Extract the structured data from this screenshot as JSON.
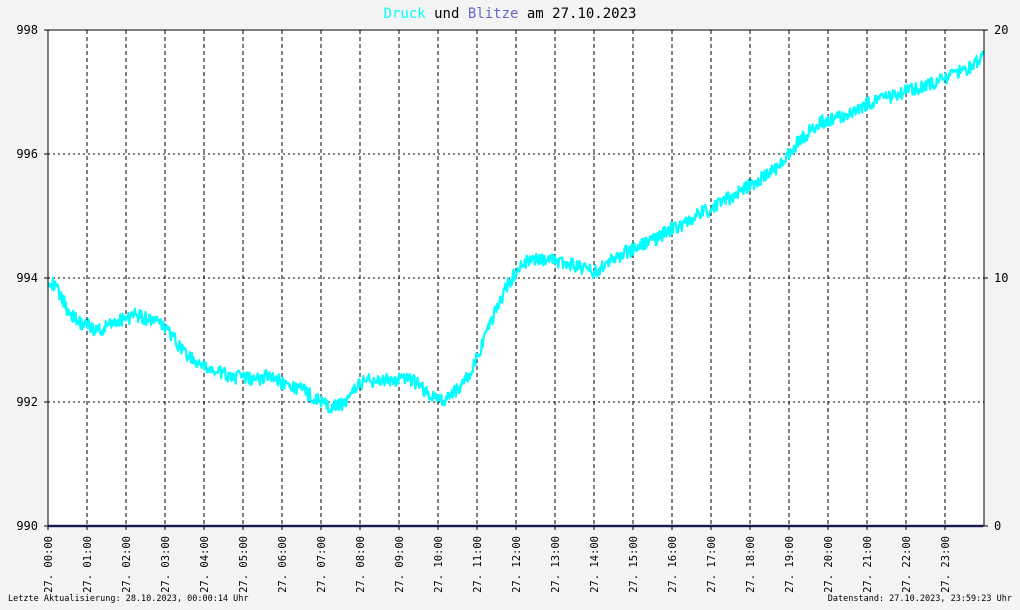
{
  "chart_data": {
    "type": "line",
    "title": {
      "part1": "Druck",
      "part2": " und ",
      "part3": "Blitze",
      "part4": " am 27.10.2023"
    },
    "y_left": {
      "ylim": [
        990,
        998
      ],
      "ticks": [
        "990",
        "992",
        "994",
        "996",
        "998"
      ]
    },
    "y_right": {
      "ylim": [
        0,
        20
      ],
      "ticks": [
        "0",
        "10",
        "20"
      ]
    },
    "x_ticks": [
      "27. 00:00",
      "27. 01:00",
      "27. 02:00",
      "27. 03:00",
      "27. 04:00",
      "27. 05:00",
      "27. 06:00",
      "27. 07:00",
      "27. 08:00",
      "27. 09:00",
      "27. 10:00",
      "27. 11:00",
      "27. 12:00",
      "27. 13:00",
      "27. 14:00",
      "27. 15:00",
      "27. 16:00",
      "27. 17:00",
      "27. 18:00",
      "27. 19:00",
      "27. 20:00",
      "27. 21:00",
      "27. 22:00",
      "27. 23:00"
    ],
    "grid": true,
    "colors": {
      "druck": "#00ffff",
      "blitze": "#333399",
      "title_text": "#000000"
    },
    "series": [
      {
        "name": "Druck",
        "x": [
          0,
          0.25,
          0.5,
          0.75,
          1,
          1.25,
          1.5,
          1.75,
          2,
          2.25,
          2.5,
          2.75,
          3,
          3.25,
          3.5,
          3.75,
          4,
          4.25,
          4.5,
          4.75,
          5,
          5.25,
          5.5,
          5.75,
          6,
          6.25,
          6.5,
          6.75,
          7,
          7.25,
          7.5,
          7.75,
          8,
          8.25,
          8.5,
          8.75,
          9,
          9.25,
          9.5,
          9.75,
          10,
          10.25,
          10.5,
          10.75,
          11,
          11.25,
          11.5,
          11.75,
          12,
          12.25,
          12.5,
          12.75,
          13,
          13.25,
          13.5,
          13.75,
          14,
          14.25,
          14.5,
          14.75,
          15,
          15.25,
          15.5,
          15.75,
          16,
          16.25,
          16.5,
          16.75,
          17,
          17.25,
          17.5,
          17.75,
          18,
          18.25,
          18.5,
          18.75,
          19,
          19.25,
          19.5,
          19.75,
          20,
          20.25,
          20.5,
          20.75,
          21,
          21.25,
          21.5,
          21.75,
          22,
          22.25,
          22.5,
          22.75,
          23,
          23.25,
          23.5,
          23.75,
          23.98
        ],
        "y": [
          994.0,
          993.8,
          993.5,
          993.3,
          993.25,
          993.15,
          993.2,
          993.3,
          993.35,
          993.4,
          993.35,
          993.3,
          993.2,
          993.0,
          992.8,
          992.65,
          992.55,
          992.5,
          992.45,
          992.4,
          992.4,
          992.35,
          992.4,
          992.45,
          992.3,
          992.25,
          992.2,
          992.1,
          992.0,
          991.9,
          991.95,
          992.1,
          992.3,
          992.35,
          992.35,
          992.35,
          992.35,
          992.35,
          992.3,
          992.1,
          992.05,
          992.05,
          992.2,
          992.4,
          992.7,
          993.1,
          993.5,
          993.85,
          994.1,
          994.25,
          994.3,
          994.3,
          994.28,
          994.25,
          994.2,
          994.15,
          994.1,
          994.2,
          994.3,
          994.4,
          994.45,
          994.55,
          994.6,
          994.7,
          994.8,
          994.85,
          994.95,
          995.05,
          995.1,
          995.2,
          995.3,
          995.4,
          995.5,
          995.6,
          995.7,
          995.8,
          996.0,
          996.2,
          996.35,
          996.5,
          996.55,
          996.6,
          996.65,
          996.75,
          996.8,
          996.85,
          996.9,
          996.95,
          997.0,
          997.05,
          997.1,
          997.15,
          997.2,
          997.3,
          997.35,
          997.45,
          997.6
        ]
      },
      {
        "name": "Blitze",
        "x": [
          0,
          23.98
        ],
        "y": [
          0,
          0
        ]
      }
    ],
    "footer_left": "Letzte Aktualisierung: 28.10.2023, 00:00:14 Uhr",
    "footer_right": "Datenstand: 27.10.2023, 23:59:23 Uhr"
  }
}
